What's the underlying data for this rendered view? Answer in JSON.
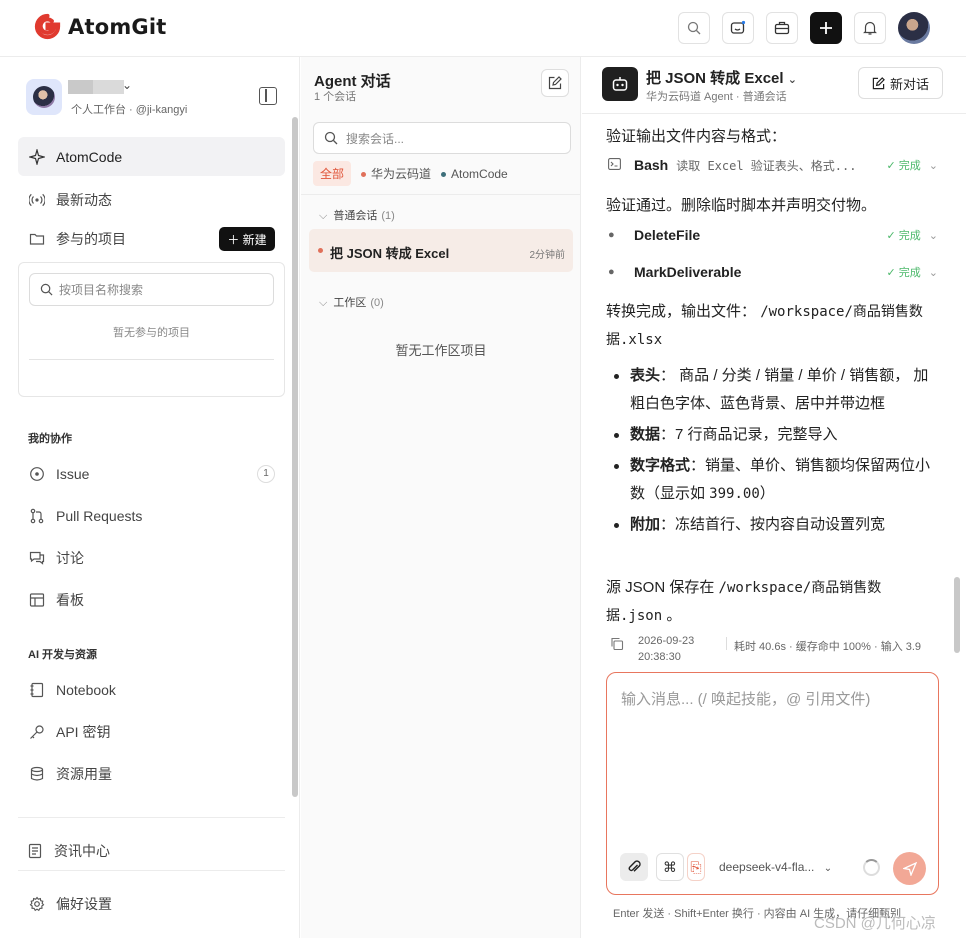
{
  "header": {
    "brand": "AtomGit",
    "brand_color": "#e03a2f",
    "actions": [
      "search-icon",
      "ai-assistant-icon",
      "briefcase-icon",
      "plus-icon",
      "bell-icon",
      "avatar"
    ]
  },
  "sidebar": {
    "user": {
      "subtitle": "个人工作台 · @ji-kangyi"
    },
    "items": [
      {
        "label": "AtomCode",
        "icon": "sparkle-icon",
        "active": true
      },
      {
        "label": "最新动态",
        "icon": "broadcast-icon"
      },
      {
        "label": "参与的项目",
        "icon": "folder-icon"
      }
    ],
    "new_button": "新建",
    "project_search_placeholder": "按项目名称搜索",
    "project_empty": "暂无参与的项目",
    "collab_title": "我的协作",
    "collab_items": [
      {
        "label": "Issue",
        "icon": "issue-icon",
        "count": "1"
      },
      {
        "label": "Pull Requests",
        "icon": "pull-request-icon"
      },
      {
        "label": "讨论",
        "icon": "discussion-icon"
      },
      {
        "label": "看板",
        "icon": "board-icon"
      }
    ],
    "ai_title": "AI 开发与资源",
    "ai_items": [
      {
        "label": "Notebook",
        "icon": "notebook-icon"
      },
      {
        "label": "API 密钥",
        "icon": "key-icon"
      },
      {
        "label": "资源用量",
        "icon": "database-icon"
      }
    ],
    "news": "资讯中心",
    "settings": "偏好设置"
  },
  "middle": {
    "title": "Agent 对话",
    "subtitle": "1 个会话",
    "search_placeholder": "搜索会话...",
    "filters": [
      {
        "label": "全部",
        "active": true
      },
      {
        "label": "华为云码道",
        "dot": "#e0705a"
      },
      {
        "label": "AtomCode",
        "dot": "#3d6f7a"
      }
    ],
    "group_normal": {
      "label": "普通会话",
      "count": "(1)"
    },
    "conversation": {
      "title": "把 JSON 转成 Excel",
      "time": "2分钟前"
    },
    "group_workspace": {
      "label": "工作区",
      "count": "(0)"
    },
    "workspace_empty": "暂无工作区项目"
  },
  "chat": {
    "title": "把 JSON 转成 Excel",
    "subtitle": "华为云码道 Agent · 普通会话",
    "new_chat": "新对话",
    "msg1": "验证输出文件内容与格式：",
    "tool_bash": {
      "name": "Bash",
      "desc": "读取 Excel 验证表头、格式...",
      "status": "完成"
    },
    "msg2": "验证通过。删除临时脚本并声明交付物。",
    "tool_delete": {
      "name": "DeleteFile",
      "status": "完成"
    },
    "tool_mark": {
      "name": "MarkDeliverable",
      "status": "完成"
    },
    "msg3_prefix": "转换完成，输出文件：",
    "msg3_path1": "/workspace/商品销售数",
    "msg3_path2": "据.xlsx",
    "bullets": [
      {
        "key": "表头",
        "text": "： 商品 / 分类 / 销量 / 单价 / 销售额， 加粗白色字体、蓝色背景、居中并带边框"
      },
      {
        "key": "数据",
        "text": "：7 行商品记录，完整导入"
      },
      {
        "key": "数字格式",
        "text_a": "：销量、单价、销售额均保留两位小数（显示如 ",
        "code": "399.00",
        "text_b": "）"
      },
      {
        "key": "附加",
        "text": "：冻结首行、按内容自动设置列宽"
      }
    ],
    "msg4_prefix": "源 JSON 保存在",
    "msg4_path1": "/workspace/商品销售数",
    "msg4_path2": "据.json",
    "msg4_suffix": "。",
    "meta_date": "2026-09-23",
    "meta_time": "20:38:30",
    "meta_stats": "耗时 40.6s · 缓存命中 100% · 输入 3.9",
    "composer_placeholder": "输入消息...  (/ 唤起技能，@ 引用文件)",
    "model": "deepseek-v4-fla...",
    "footnote": "Enter 发送 · Shift+Enter 换行 · 内容由 AI 生成，请仔细甄别",
    "accent": "#e8765e",
    "done_color": "#4bb86a"
  },
  "watermark": "CSDN @几何心凉"
}
